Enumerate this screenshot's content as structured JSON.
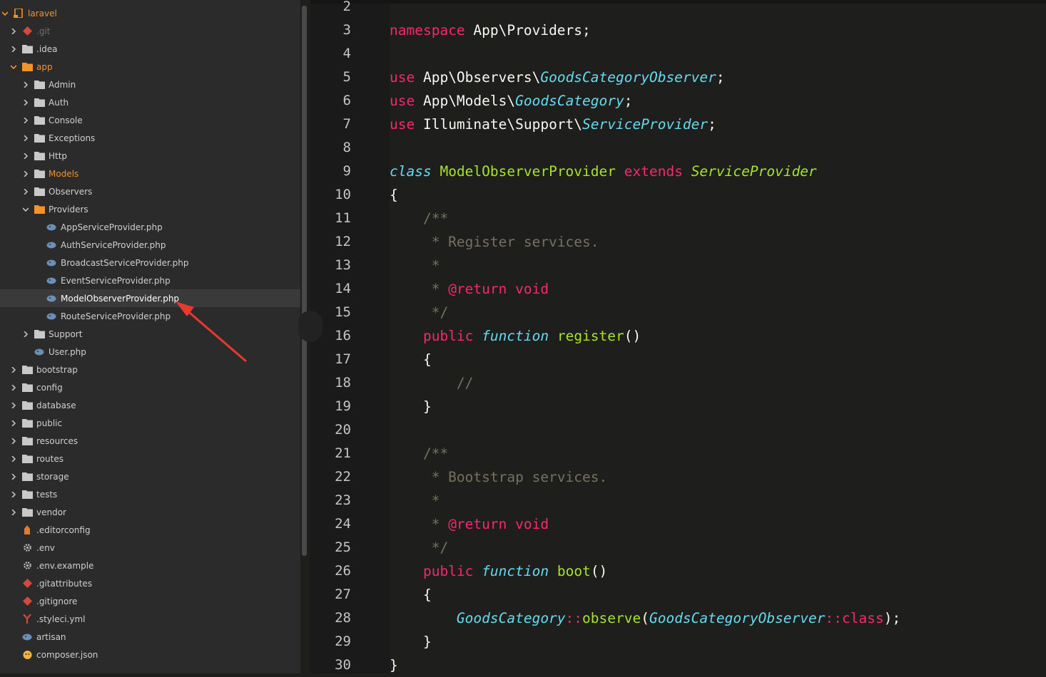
{
  "sidebar": {
    "items": [
      {
        "label": "laravel",
        "depth": 0,
        "type": "folder",
        "expanded": true,
        "icon": "project-icon",
        "style": "orange"
      },
      {
        "label": ".git",
        "depth": 1,
        "type": "folder",
        "expanded": false,
        "icon": "git-icon",
        "style": "dim"
      },
      {
        "label": ".idea",
        "depth": 1,
        "type": "folder",
        "expanded": false,
        "icon": "folder-icon",
        "style": ""
      },
      {
        "label": "app",
        "depth": 1,
        "type": "folder",
        "expanded": true,
        "icon": "folder-open-icon",
        "style": "orange"
      },
      {
        "label": "Admin",
        "depth": 2,
        "type": "folder",
        "expanded": false,
        "icon": "folder-icon",
        "style": ""
      },
      {
        "label": "Auth",
        "depth": 2,
        "type": "folder",
        "expanded": false,
        "icon": "folder-icon",
        "style": ""
      },
      {
        "label": "Console",
        "depth": 2,
        "type": "folder",
        "expanded": false,
        "icon": "folder-icon",
        "style": ""
      },
      {
        "label": "Exceptions",
        "depth": 2,
        "type": "folder",
        "expanded": false,
        "icon": "folder-icon",
        "style": ""
      },
      {
        "label": "Http",
        "depth": 2,
        "type": "folder",
        "expanded": false,
        "icon": "folder-icon",
        "style": ""
      },
      {
        "label": "Models",
        "depth": 2,
        "type": "folder",
        "expanded": false,
        "icon": "folder-icon",
        "style": "orange"
      },
      {
        "label": "Observers",
        "depth": 2,
        "type": "folder",
        "expanded": false,
        "icon": "folder-icon",
        "style": ""
      },
      {
        "label": "Providers",
        "depth": 2,
        "type": "folder",
        "expanded": true,
        "icon": "folder-open-icon",
        "style": ""
      },
      {
        "label": "AppServiceProvider.php",
        "depth": 3,
        "type": "file",
        "icon": "php-icon",
        "style": ""
      },
      {
        "label": "AuthServiceProvider.php",
        "depth": 3,
        "type": "file",
        "icon": "php-icon",
        "style": ""
      },
      {
        "label": "BroadcastServiceProvider.php",
        "depth": 3,
        "type": "file",
        "icon": "php-icon",
        "style": ""
      },
      {
        "label": "EventServiceProvider.php",
        "depth": 3,
        "type": "file",
        "icon": "php-icon",
        "style": ""
      },
      {
        "label": "ModelObserverProvider.php",
        "depth": 3,
        "type": "file",
        "icon": "php-icon",
        "style": "selected"
      },
      {
        "label": "RouteServiceProvider.php",
        "depth": 3,
        "type": "file",
        "icon": "php-icon",
        "style": ""
      },
      {
        "label": "Support",
        "depth": 2,
        "type": "folder",
        "expanded": false,
        "icon": "folder-icon",
        "style": ""
      },
      {
        "label": "User.php",
        "depth": 2,
        "type": "file",
        "icon": "php-icon",
        "style": ""
      },
      {
        "label": "bootstrap",
        "depth": 1,
        "type": "folder",
        "expanded": false,
        "icon": "folder-icon",
        "style": ""
      },
      {
        "label": "config",
        "depth": 1,
        "type": "folder",
        "expanded": false,
        "icon": "folder-icon",
        "style": ""
      },
      {
        "label": "database",
        "depth": 1,
        "type": "folder",
        "expanded": false,
        "icon": "folder-icon",
        "style": ""
      },
      {
        "label": "public",
        "depth": 1,
        "type": "folder",
        "expanded": false,
        "icon": "folder-icon",
        "style": ""
      },
      {
        "label": "resources",
        "depth": 1,
        "type": "folder",
        "expanded": false,
        "icon": "folder-icon",
        "style": ""
      },
      {
        "label": "routes",
        "depth": 1,
        "type": "folder",
        "expanded": false,
        "icon": "folder-icon",
        "style": ""
      },
      {
        "label": "storage",
        "depth": 1,
        "type": "folder",
        "expanded": false,
        "icon": "folder-icon",
        "style": ""
      },
      {
        "label": "tests",
        "depth": 1,
        "type": "folder",
        "expanded": false,
        "icon": "folder-icon",
        "style": ""
      },
      {
        "label": "vendor",
        "depth": 1,
        "type": "folder",
        "expanded": false,
        "icon": "folder-icon",
        "style": ""
      },
      {
        "label": ".editorconfig",
        "depth": 1,
        "type": "file",
        "icon": "editorconfig-icon",
        "style": ""
      },
      {
        "label": ".env",
        "depth": 1,
        "type": "file",
        "icon": "gear-icon",
        "style": ""
      },
      {
        "label": ".env.example",
        "depth": 1,
        "type": "file",
        "icon": "gear-icon",
        "style": ""
      },
      {
        "label": ".gitattributes",
        "depth": 1,
        "type": "file",
        "icon": "git-icon",
        "style": ""
      },
      {
        "label": ".gitignore",
        "depth": 1,
        "type": "file",
        "icon": "git-icon",
        "style": ""
      },
      {
        "label": ".styleci.yml",
        "depth": 1,
        "type": "file",
        "icon": "yaml-icon",
        "style": ""
      },
      {
        "label": "artisan",
        "depth": 1,
        "type": "file",
        "icon": "php-icon",
        "style": ""
      },
      {
        "label": "composer.json",
        "depth": 1,
        "type": "file",
        "icon": "composer-icon",
        "style": ""
      }
    ]
  },
  "editor": {
    "lines": [
      {
        "n": "2",
        "tokens": []
      },
      {
        "n": "3",
        "tokens": [
          {
            "t": "namespace",
            "c": "kw"
          },
          {
            "t": " App\\Providers;",
            "c": ""
          }
        ]
      },
      {
        "n": "4",
        "tokens": []
      },
      {
        "n": "5",
        "tokens": [
          {
            "t": "use",
            "c": "kw"
          },
          {
            "t": " App\\Observers\\",
            "c": ""
          },
          {
            "t": "GoodsCategoryObserver",
            "c": "blue it"
          },
          {
            "t": ";",
            "c": ""
          }
        ]
      },
      {
        "n": "6",
        "tokens": [
          {
            "t": "use",
            "c": "kw"
          },
          {
            "t": " App\\Models\\",
            "c": ""
          },
          {
            "t": "GoodsCategory",
            "c": "blue it"
          },
          {
            "t": ";",
            "c": ""
          }
        ]
      },
      {
        "n": "7",
        "tokens": [
          {
            "t": "use",
            "c": "kw"
          },
          {
            "t": " Illuminate\\Support\\",
            "c": ""
          },
          {
            "t": "ServiceProvider",
            "c": "blue it"
          },
          {
            "t": ";",
            "c": ""
          }
        ]
      },
      {
        "n": "8",
        "tokens": []
      },
      {
        "n": "9",
        "tokens": [
          {
            "t": "class",
            "c": "blue it"
          },
          {
            "t": " ",
            "c": ""
          },
          {
            "t": "ModelObserverProvider",
            "c": "cls"
          },
          {
            "t": " ",
            "c": ""
          },
          {
            "t": "extends",
            "c": "kw"
          },
          {
            "t": " ",
            "c": ""
          },
          {
            "t": "ServiceProvider",
            "c": "cls it"
          }
        ]
      },
      {
        "n": "10",
        "tokens": [
          {
            "t": "{",
            "c": ""
          }
        ]
      },
      {
        "n": "11",
        "tokens": [
          {
            "t": "    /**",
            "c": "cmt"
          }
        ]
      },
      {
        "n": "12",
        "tokens": [
          {
            "t": "     * Register services.",
            "c": "cmt"
          }
        ]
      },
      {
        "n": "13",
        "tokens": [
          {
            "t": "     *",
            "c": "cmt"
          }
        ]
      },
      {
        "n": "14",
        "tokens": [
          {
            "t": "     * ",
            "c": "cmt"
          },
          {
            "t": "@return",
            "c": "kw"
          },
          {
            "t": " ",
            "c": ""
          },
          {
            "t": "void",
            "c": "kw"
          }
        ]
      },
      {
        "n": "15",
        "tokens": [
          {
            "t": "     */",
            "c": "cmt"
          }
        ]
      },
      {
        "n": "16",
        "tokens": [
          {
            "t": "    ",
            "c": ""
          },
          {
            "t": "public",
            "c": "kw"
          },
          {
            "t": " ",
            "c": ""
          },
          {
            "t": "function",
            "c": "blue it"
          },
          {
            "t": " ",
            "c": ""
          },
          {
            "t": "register",
            "c": "fn"
          },
          {
            "t": "()",
            "c": ""
          }
        ]
      },
      {
        "n": "17",
        "tokens": [
          {
            "t": "    {",
            "c": ""
          }
        ]
      },
      {
        "n": "18",
        "tokens": [
          {
            "t": "        //",
            "c": "cmt"
          }
        ]
      },
      {
        "n": "19",
        "tokens": [
          {
            "t": "    }",
            "c": ""
          }
        ]
      },
      {
        "n": "20",
        "tokens": []
      },
      {
        "n": "21",
        "tokens": [
          {
            "t": "    /**",
            "c": "cmt"
          }
        ]
      },
      {
        "n": "22",
        "tokens": [
          {
            "t": "     * Bootstrap services.",
            "c": "cmt"
          }
        ]
      },
      {
        "n": "23",
        "tokens": [
          {
            "t": "     *",
            "c": "cmt"
          }
        ]
      },
      {
        "n": "24",
        "tokens": [
          {
            "t": "     * ",
            "c": "cmt"
          },
          {
            "t": "@return",
            "c": "kw"
          },
          {
            "t": " ",
            "c": ""
          },
          {
            "t": "void",
            "c": "kw"
          }
        ]
      },
      {
        "n": "25",
        "tokens": [
          {
            "t": "     */",
            "c": "cmt"
          }
        ]
      },
      {
        "n": "26",
        "tokens": [
          {
            "t": "    ",
            "c": ""
          },
          {
            "t": "public",
            "c": "kw"
          },
          {
            "t": " ",
            "c": ""
          },
          {
            "t": "function",
            "c": "blue it"
          },
          {
            "t": " ",
            "c": ""
          },
          {
            "t": "boot",
            "c": "fn"
          },
          {
            "t": "()",
            "c": ""
          }
        ]
      },
      {
        "n": "27",
        "tokens": [
          {
            "t": "    {",
            "c": ""
          }
        ]
      },
      {
        "n": "28",
        "tokens": [
          {
            "t": "        ",
            "c": ""
          },
          {
            "t": "GoodsCategory",
            "c": "blue it"
          },
          {
            "t": "::",
            "c": "kw"
          },
          {
            "t": "observe",
            "c": "fn"
          },
          {
            "t": "(",
            "c": ""
          },
          {
            "t": "GoodsCategoryObserver",
            "c": "blue it"
          },
          {
            "t": "::",
            "c": "kw"
          },
          {
            "t": "class",
            "c": "kw"
          },
          {
            "t": ");",
            "c": ""
          }
        ]
      },
      {
        "n": "29",
        "tokens": [
          {
            "t": "    }",
            "c": ""
          }
        ]
      },
      {
        "n": "30",
        "tokens": [
          {
            "t": "}",
            "c": ""
          }
        ]
      }
    ]
  },
  "colors": {
    "keyword": "#f92672",
    "type": "#66d9ef",
    "function": "#a6e22e",
    "comment": "#75715e",
    "accent": "#f5932a",
    "annotation_arrow": "#e8392f"
  }
}
